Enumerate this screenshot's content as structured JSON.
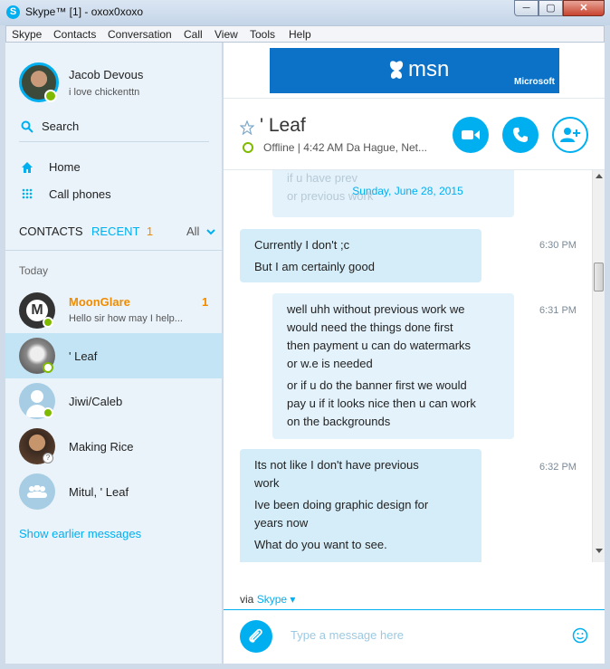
{
  "window": {
    "title": "Skype™ [1] - oxox0xoxo",
    "min": "─",
    "max": "▢",
    "close": "✕"
  },
  "menu": [
    "Skype",
    "Contacts",
    "Conversation",
    "Call",
    "View",
    "Tools",
    "Help"
  ],
  "profile": {
    "name": "Jacob Devous",
    "mood": "i love chickenttn"
  },
  "search": {
    "label": "Search"
  },
  "nav": {
    "home": "Home",
    "call_phones": "Call phones"
  },
  "tabs": {
    "contacts": "CONTACTS",
    "recent": "RECENT",
    "recent_count": "1",
    "all": "All"
  },
  "section": {
    "today": "Today"
  },
  "contacts": [
    {
      "name": "MoonGlare",
      "preview": "Hello sir how may I help...",
      "badge": "1"
    },
    {
      "name": "' Leaf"
    },
    {
      "name": "Jiwi/Caleb"
    },
    {
      "name": "Making Rice"
    },
    {
      "name": "Mitul, ' Leaf"
    }
  ],
  "show_earlier": "Show earlier messages",
  "ad": {
    "brand": "msn",
    "company": "Microsoft"
  },
  "conversation": {
    "name": "' Leaf",
    "status": "Offline | 4:42 AM Da Hague, Net..."
  },
  "chat": {
    "faded_lines": [
      "if u have prev",
      "or previous work"
    ],
    "date": "Sunday, June 28, 2015",
    "messages": [
      {
        "time": "6:30 PM",
        "lines": [
          "Currently I don't ;c",
          "But I am certainly good"
        ]
      },
      {
        "time": "6:31 PM",
        "lines": [
          "well uhh without previous work we",
          "would need the things done first",
          "then payment u can do watermarks",
          "or w.e is needed",
          "or if u do the banner first we would",
          "pay u if it looks nice then u can work",
          "on the backgrounds"
        ]
      },
      {
        "time": "6:32 PM",
        "lines": [
          "Its not like I don't have previous",
          "work",
          "Ive been doing graphic design for",
          "years now",
          "What do you want to see."
        ]
      }
    ]
  },
  "via": {
    "prefix": "via",
    "service": "Skype ▾"
  },
  "composer": {
    "placeholder": "Type a message here"
  },
  "colors": {
    "accent": "#00aff0",
    "unread": "#f08c00",
    "online": "#7fba00"
  }
}
